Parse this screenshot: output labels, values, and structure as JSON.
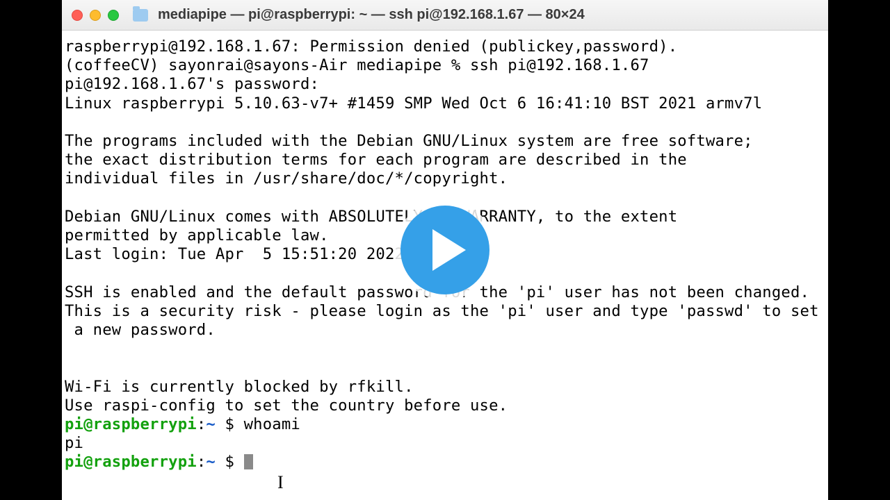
{
  "window": {
    "title": "mediapipe — pi@raspberrypi: ~ — ssh pi@192.168.1.67 — 80×24"
  },
  "terminal": {
    "lines": [
      "raspberrypi@192.168.1.67: Permission denied (publickey,password).",
      "(coffeeCV) sayonrai@sayons-Air mediapipe % ssh pi@192.168.1.67",
      "pi@192.168.1.67's password:",
      "Linux raspberrypi 5.10.63-v7+ #1459 SMP Wed Oct 6 16:41:10 BST 2021 armv7l",
      "",
      "The programs included with the Debian GNU/Linux system are free software;",
      "the exact distribution terms for each program are described in the",
      "individual files in /usr/share/doc/*/copyright.",
      "",
      "Debian GNU/Linux comes with ABSOLUTELY NO WARRANTY, to the extent",
      "permitted by applicable law.",
      "Last login: Tue Apr  5 15:51:20 2022",
      "",
      "SSH is enabled and the default password for the 'pi' user has not been changed.",
      "This is a security risk - please login as the 'pi' user and type 'passwd' to set",
      " a new password.",
      "",
      "",
      "Wi-Fi is currently blocked by rfkill.",
      "Use raspi-config to set the country before use."
    ],
    "prompt1": {
      "user": "pi@raspberrypi",
      "sep": ":",
      "path": "~",
      "sym": " $ ",
      "cmd": "whoami"
    },
    "output1": "pi",
    "prompt2": {
      "user": "pi@raspberrypi",
      "sep": ":",
      "path": "~",
      "sym": " $ "
    }
  },
  "overlay": {
    "play": true
  }
}
